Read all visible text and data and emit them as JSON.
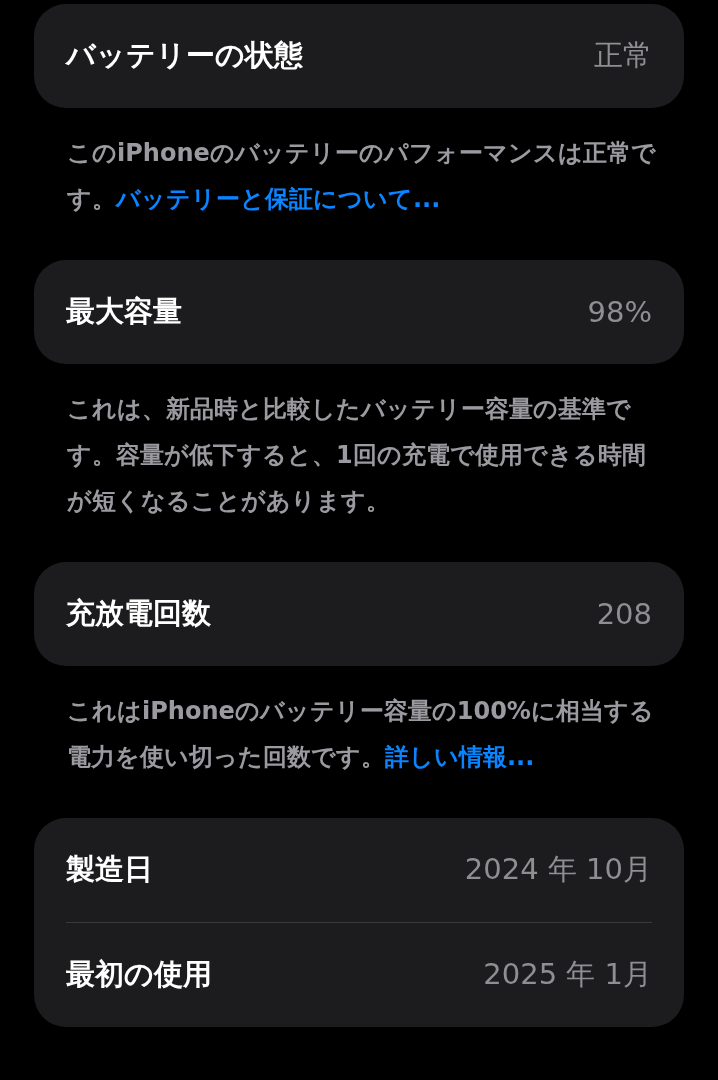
{
  "sections": [
    {
      "rows": [
        {
          "label": "バッテリーの状態",
          "value": "正常"
        }
      ],
      "footer": {
        "text": "このiPhoneのバッテリーのパフォーマンスは正常です。",
        "link": "バッテリーと保証について..."
      }
    },
    {
      "rows": [
        {
          "label": "最大容量",
          "value": "98%"
        }
      ],
      "footer": {
        "text": "これは、新品時と比較したバッテリー容量の基準です。容量が低下すると、1回の充電で使用できる時間が短くなることがあります。"
      }
    },
    {
      "rows": [
        {
          "label": "充放電回数",
          "value": "208"
        }
      ],
      "footer": {
        "text": "これはiPhoneのバッテリー容量の100%に相当する電力を使い切った回数です。",
        "link": "詳しい情報..."
      }
    },
    {
      "rows": [
        {
          "label": "製造日",
          "value": "2024 年 10月"
        },
        {
          "label": "最初の使用",
          "value": "2025 年 1月"
        }
      ]
    }
  ]
}
